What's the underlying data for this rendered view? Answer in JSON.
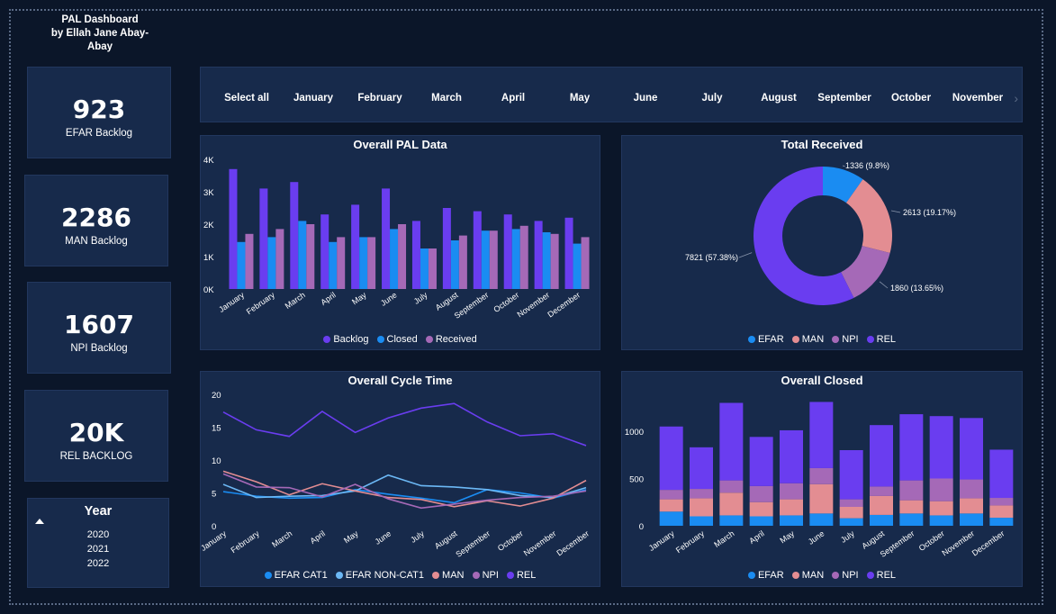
{
  "header": {
    "title": "PAL Dashboard",
    "author": "by Ellah Jane Abay-Abay"
  },
  "kpis": [
    {
      "value": "923",
      "label": "EFAR Backlog"
    },
    {
      "value": "2286",
      "label": "MAN Backlog"
    },
    {
      "value": "1607",
      "label": "NPI Backlog"
    },
    {
      "value": "20K",
      "label": "REL BACKLOG"
    }
  ],
  "year_slicer": {
    "title": "Year",
    "options": [
      "2020",
      "2021",
      "2022"
    ]
  },
  "month_slicer": {
    "items": [
      "Select all",
      "January",
      "February",
      "March",
      "April",
      "May",
      "June",
      "July",
      "August",
      "September",
      "October",
      "November"
    ]
  },
  "colors": {
    "backlog": "#6a3df0",
    "closed": "#1a8cf2",
    "received": "#a569b7",
    "efar": "#1a8cf2",
    "man": "#e38d92",
    "npi": "#a569b7",
    "rel": "#6a3df0",
    "cat1": "#1a8cf2",
    "noncat1": "#6cb8f5"
  },
  "chart_data": [
    {
      "type": "bar",
      "title": "Overall PAL Data",
      "categories": [
        "January",
        "February",
        "March",
        "April",
        "May",
        "June",
        "July",
        "August",
        "September",
        "October",
        "November",
        "December"
      ],
      "series": [
        {
          "name": "Backlog",
          "values": [
            3700,
            3100,
            3300,
            2300,
            2600,
            3100,
            2100,
            2500,
            2400,
            2300,
            2100,
            2200
          ]
        },
        {
          "name": "Closed",
          "values": [
            1450,
            1600,
            2100,
            1450,
            1600,
            1850,
            1250,
            1500,
            1800,
            1850,
            1750,
            1400
          ]
        },
        {
          "name": "Received",
          "values": [
            1700,
            1850,
            2000,
            1600,
            1600,
            2000,
            1250,
            1650,
            1800,
            1950,
            1700,
            1600
          ]
        }
      ],
      "yticks": [
        "0K",
        "1K",
        "2K",
        "3K",
        "4K"
      ],
      "ylim": [
        0,
        4000
      ]
    },
    {
      "type": "pie",
      "title": "Total Received",
      "slices": [
        {
          "name": "EFAR",
          "value": 1336,
          "label": "1336 (9.8%)"
        },
        {
          "name": "MAN",
          "value": 2613,
          "label": "2613 (19.17%)"
        },
        {
          "name": "NPI",
          "value": 1860,
          "label": "1860 (13.65%)"
        },
        {
          "name": "REL",
          "value": 7821,
          "label": "7821 (57.38%)"
        }
      ]
    },
    {
      "type": "line",
      "title": "Overall Cycle Time",
      "categories": [
        "January",
        "February",
        "March",
        "April",
        "May",
        "June",
        "July",
        "August",
        "September",
        "October",
        "November",
        "December"
      ],
      "series": [
        {
          "name": "EFAR CAT1",
          "values": [
            5.2,
            4.5,
            4.2,
            4.3,
            5.5,
            4.8,
            4.2,
            3.5,
            5.5,
            5.0,
            4.2,
            5.5
          ]
        },
        {
          "name": "EFAR NON-CAT1",
          "values": [
            6.3,
            4.3,
            4.5,
            4.6,
            5.3,
            7.7,
            6.1,
            5.9,
            5.5,
            4.6,
            4.3,
            5.8
          ]
        },
        {
          "name": "MAN",
          "values": [
            8.3,
            6.7,
            4.7,
            6.4,
            5.3,
            4.3,
            4.0,
            2.9,
            3.8,
            3.0,
            4.2,
            6.9
          ]
        },
        {
          "name": "NPI",
          "values": [
            7.9,
            5.9,
            5.8,
            4.4,
            6.3,
            4.1,
            2.7,
            3.3,
            3.9,
            4.3,
            4.5,
            5.3
          ]
        },
        {
          "name": "REL",
          "values": [
            17.3,
            14.6,
            13.6,
            17.4,
            14.2,
            16.4,
            17.9,
            18.6,
            15.8,
            13.7,
            14.0,
            12.2
          ]
        }
      ],
      "yticks": [
        "0",
        "5",
        "10",
        "15",
        "20"
      ],
      "ylim": [
        0,
        20
      ]
    },
    {
      "type": "bar",
      "stacked": true,
      "title": "Overall Closed",
      "categories": [
        "January",
        "February",
        "March",
        "April",
        "May",
        "June",
        "July",
        "August",
        "September",
        "October",
        "November",
        "December"
      ],
      "series": [
        {
          "name": "EFAR",
          "values": [
            150,
            100,
            110,
            100,
            110,
            130,
            80,
            115,
            130,
            110,
            130,
            85
          ]
        },
        {
          "name": "MAN",
          "values": [
            130,
            190,
            240,
            150,
            170,
            310,
            120,
            200,
            140,
            150,
            160,
            130
          ]
        },
        {
          "name": "NPI",
          "values": [
            100,
            100,
            130,
            170,
            170,
            170,
            80,
            100,
            210,
            240,
            200,
            80
          ]
        },
        {
          "name": "REL",
          "values": [
            670,
            440,
            820,
            520,
            560,
            700,
            520,
            650,
            700,
            660,
            650,
            510
          ]
        }
      ],
      "yticks": [
        "0",
        "500",
        "1000"
      ],
      "ylim": [
        0,
        1400
      ]
    }
  ]
}
